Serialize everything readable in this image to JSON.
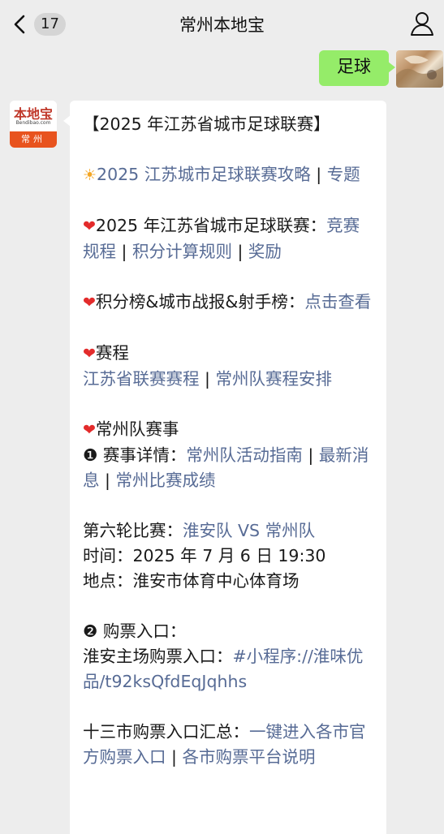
{
  "header": {
    "back_count": "17",
    "title": "常州本地宝"
  },
  "self_message": {
    "text": "足球"
  },
  "bot": {
    "logo_text": "本地宝",
    "logo_domain": "Bendibao.com",
    "logo_city": "常州"
  },
  "message": {
    "heading": "【2025 年江苏省城市足球联赛】",
    "l1_link_a": "2025 江苏城市足球联赛攻略",
    "l1_sep": " | ",
    "l1_link_b": "专题",
    "l2_text": "2025 年江苏省城市足球联赛：",
    "l2_link_a": "竞赛规程",
    "l2_link_b": "积分计算规则",
    "l2_link_c": "奖励",
    "l3_text": "积分榜&城市战报&射手榜：",
    "l3_link": "点击查看",
    "l4_text": "赛程",
    "l4_link_a": "江苏省联赛赛程",
    "l4_link_b": "常州队赛程安排",
    "l5_text": "常州队赛事",
    "l5_item1_label": "❶ 赛事详情：",
    "l5_link_a": "常州队活动指南",
    "l5_link_b": "最新消息",
    "l5_link_c": "常州比赛成绩",
    "match_label": "第六轮比赛：",
    "match_link": "淮安队 VS 常州队",
    "time_line": "时间：2025 年 7 月 6 日 19:30",
    "place_line": "地点：淮安市体育中心体育场",
    "ticket_label": "❷ 购票入口：",
    "ticket_home_label": "淮安主场购票入口：",
    "ticket_home_link": "#小程序://淮味优品/t92ksQfdEqJqhhs",
    "ticket_all_label": "十三市购票入口汇总：",
    "ticket_all_link_a": "一键进入各市官方购票入口",
    "ticket_all_link_b": "各市购票平台说明",
    "emoji_sun": "☀",
    "emoji_heart": "❤"
  },
  "colors": {
    "link": "#576b95",
    "self_bubble": "#95ec69",
    "background": "#ededed",
    "heart": "#e32b2b"
  }
}
